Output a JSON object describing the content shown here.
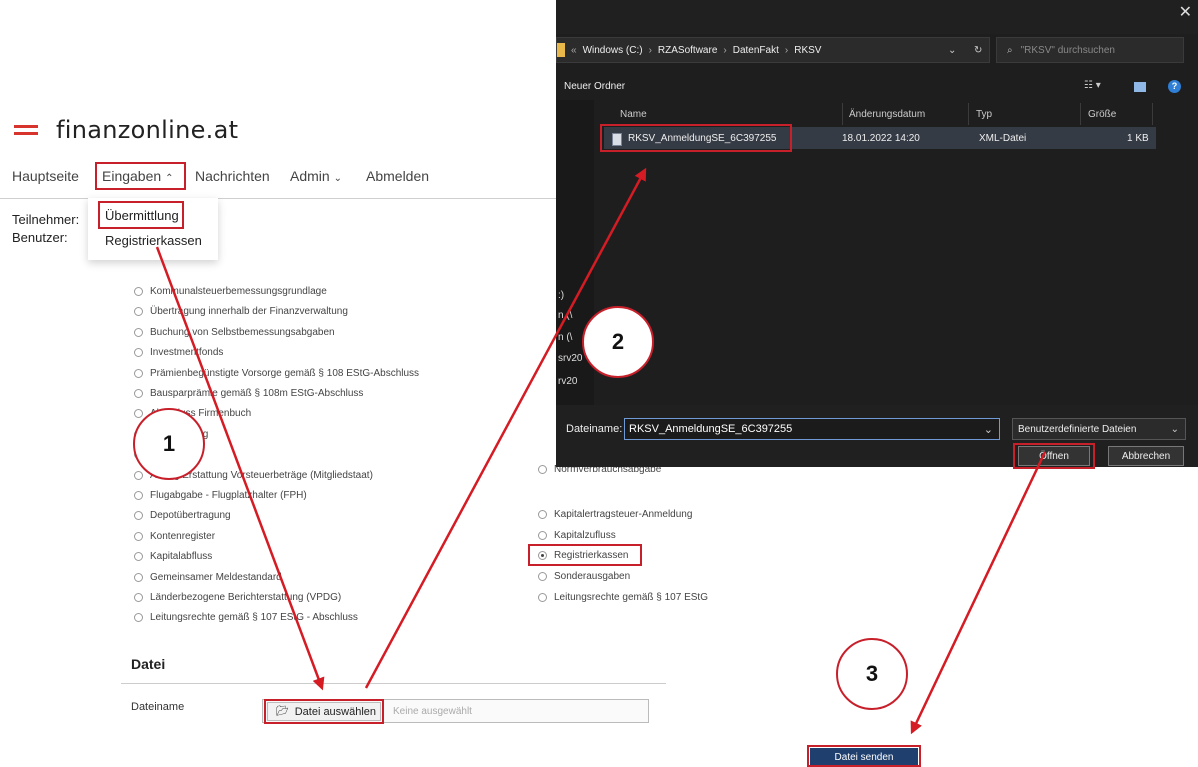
{
  "logo": {
    "text": "finanzonline.at"
  },
  "nav": {
    "items": [
      "Hauptseite",
      "Eingaben",
      "Nachrichten",
      "Admin",
      "Abmelden"
    ],
    "caret_up": "⌃",
    "caret_down": "⌄"
  },
  "info": {
    "teilnehmer_label": "Teilnehmer:",
    "benutzer_label": "Benutzer:"
  },
  "dropdown": {
    "items": [
      "Übermittlung",
      "Registrierkassen"
    ]
  },
  "options_left": [
    "Kommunalsteuerbemessungsgrundlage",
    "Übertragung innerhalb der Finanzverwaltung",
    "Buchung von Selbstbemessungsabgaben",
    "Investmentfonds",
    "Prämienbegünstigte Vorsorge gemäß § 108 EStG-Abschluss",
    "Bausparprämie gemäß § 108m EStG-Abschluss",
    "Abschluss Firmenbuch",
    "Versicherung",
    "Zulassung",
    "Antrag Erstattung Vorsteuerbeträge (Mitgliedstaat)",
    "Flugabgabe - Flugplatzhalter (FPH)",
    "Depotübertragung",
    "Kontenregister",
    "Kapitalabfluss",
    "Gemeinsamer Meldestandard",
    "Länderbezogene Berichterstattung (VPDG)",
    "Leitungsrechte gemäß § 107 EStG - Abschluss"
  ],
  "options_right": [
    "Normverbrauchsabgabe",
    "Kapitalertragsteuer-Anmeldung",
    "Kapitalzufluss",
    "Registrierkassen",
    "Sonderausgaben",
    "Leitungsrechte gemäß § 107 EStG"
  ],
  "options_right_selected": "Registrierkassen",
  "datei": {
    "section_title": "Datei",
    "filename_label": "Dateiname",
    "choose_button": "Datei auswählen",
    "no_file": "Keine ausgewählt",
    "send_button": "Datei senden"
  },
  "badges": [
    "1",
    "2",
    "3"
  ],
  "dialog": {
    "close": "✕",
    "breadcrumb": [
      "«",
      "Windows (C:)",
      "RZASoftware",
      "DatenFakt",
      "RKSV"
    ],
    "breadcrumb_sep": "›",
    "search_placeholder": "\"RKSV\" durchsuchen",
    "new_folder": "Neuer Ordner",
    "columns": [
      "Name",
      "Änderungsdatum",
      "Typ",
      "Größe"
    ],
    "file": {
      "name": "RKSV_AnmeldungSE_6C397255",
      "date": "18.01.2022 14:20",
      "type": "XML-Datei",
      "size": "1 KB"
    },
    "filename_label": "Dateiname:",
    "filename_value": "RKSV_AnmeldungSE_6C397255",
    "filetype": "Benutzerdefinierte Dateien",
    "open_button": "Öffnen",
    "cancel_button": "Abbrechen",
    "nav_partial": [
      ":)",
      "n (\\",
      "n (\\",
      "srv20",
      "rv20"
    ]
  },
  "colors": {
    "brand_red": "#d6342c",
    "annotation_red": "#c8202b",
    "send_button": "#1f3f6e",
    "dialog_bg": "#1e1e1e"
  }
}
